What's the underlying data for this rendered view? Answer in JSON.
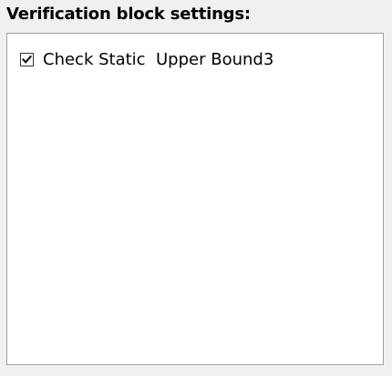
{
  "header": {
    "title": "Verification block settings:"
  },
  "list": {
    "items": [
      {
        "label": "Check Static  Upper Bound3",
        "checked": true
      }
    ]
  },
  "colors": {
    "background": "#f0f0f0",
    "list_background": "#ffffff",
    "list_border": "#a0a0a0",
    "text": "#000000"
  },
  "icons": {
    "checkmark": "checkmark-icon"
  }
}
